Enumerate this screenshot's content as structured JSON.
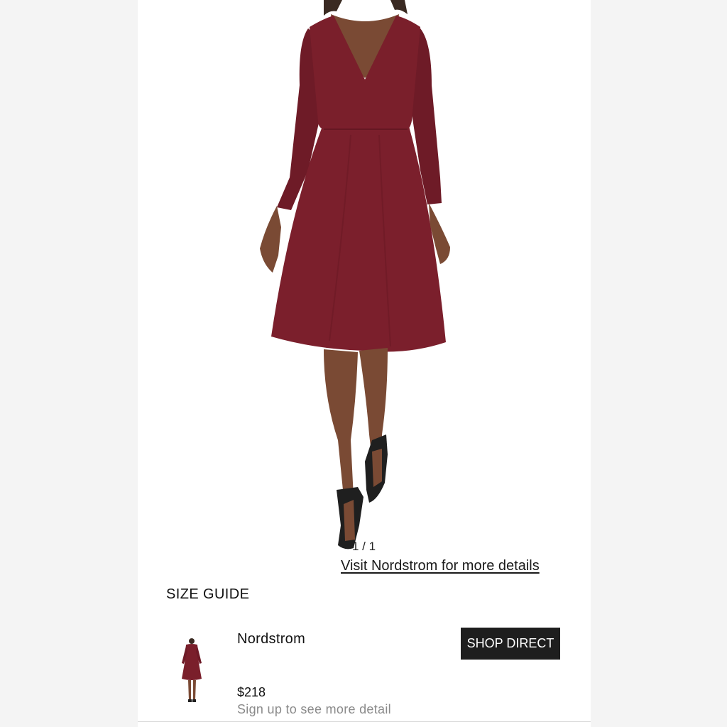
{
  "gallery": {
    "counter": "1 / 1",
    "visit_link": "Visit Nordstrom for more details"
  },
  "size_guide": {
    "label": "SIZE GUIDE"
  },
  "offer": {
    "retailer": "Nordstrom",
    "shop_button": "SHOP DIRECT",
    "price": "$218",
    "signup_text": "Sign up to see more detail"
  },
  "colors": {
    "dress": "#7a1f2b",
    "button": "#1e1e1e",
    "muted_text": "#8a8a8a"
  }
}
